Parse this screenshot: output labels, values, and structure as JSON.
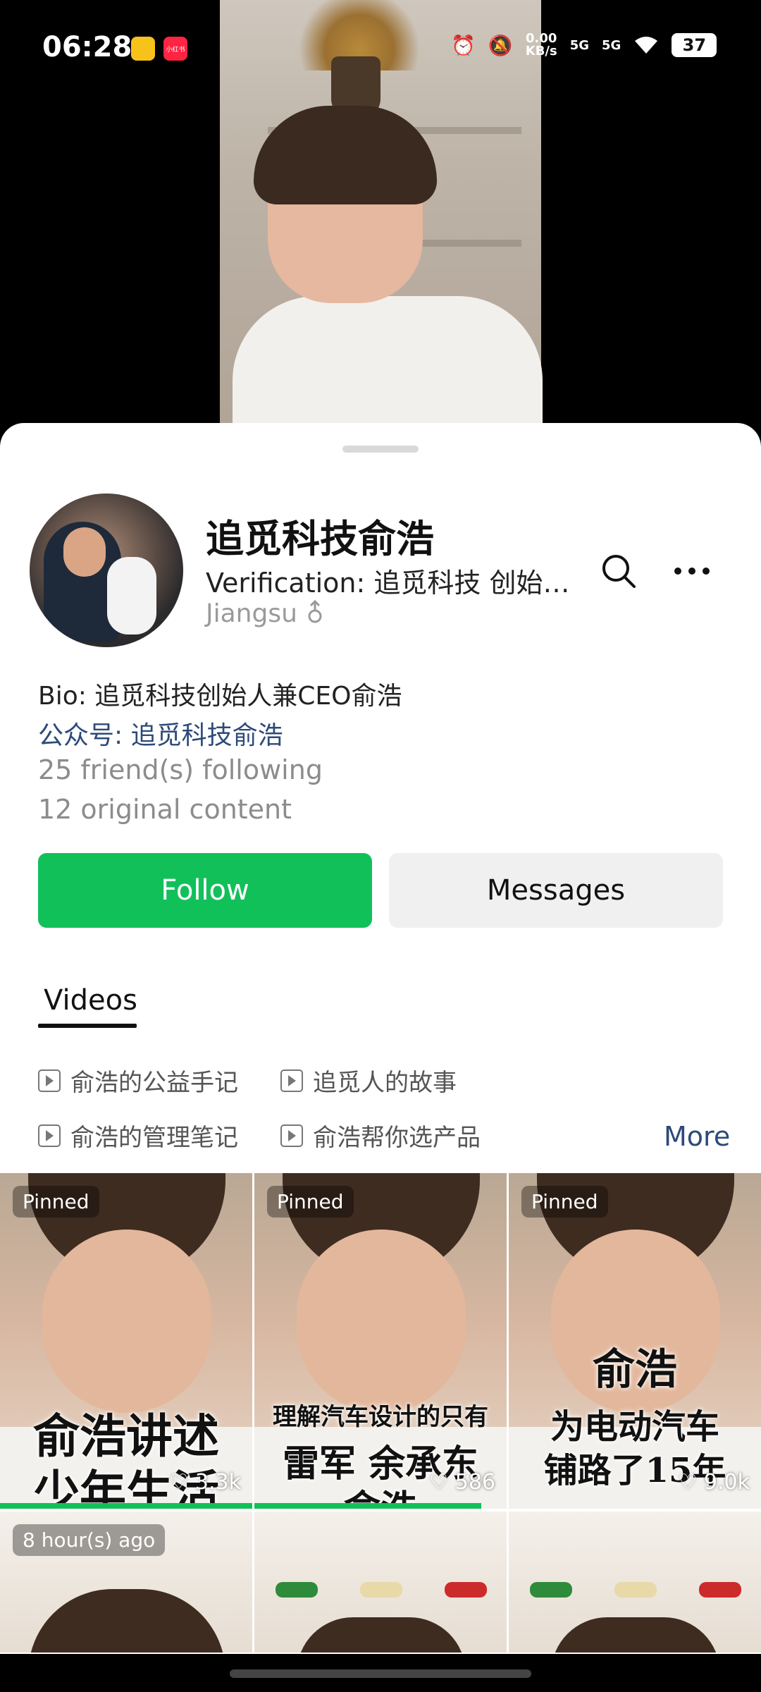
{
  "status_bar": {
    "time": "06:28",
    "net_speed_value": "0.00",
    "net_speed_unit": "KB/s",
    "signal_1": "5G",
    "signal_2": "5G",
    "battery": "37",
    "icons": [
      "weibo-app-icon",
      "xiaohongshu-app-icon",
      "alarm-icon",
      "mute-icon",
      "wifi-icon",
      "battery-icon"
    ],
    "xhs_label": "小红书"
  },
  "profile": {
    "name": "追觅科技俞浩",
    "verification": "Verification: 追觅科技 创始…",
    "region": "Jiangsu",
    "gender_icon": "male-icon",
    "bio": "Bio: 追觅科技创始人兼CEO俞浩",
    "official_account": "公众号: 追觅科技俞浩",
    "following": "25 friend(s) following",
    "original_content": "12 original content"
  },
  "actions": {
    "follow": "Follow",
    "messages": "Messages"
  },
  "tabs": {
    "videos": "Videos"
  },
  "albums": [
    {
      "label": "俞浩的公益手记"
    },
    {
      "label": "追觅人的故事"
    },
    {
      "label": "俞浩的管理笔记"
    },
    {
      "label": "俞浩帮你选产品"
    }
  ],
  "more_link": "More",
  "videos": [
    {
      "badge": "Pinned",
      "caption_line1": "俞浩讲述",
      "caption_line2": "少年生活",
      "likes": "3.3k",
      "progress": 1.0
    },
    {
      "badge": "Pinned",
      "caption_line1": "理解汽车设计的只有",
      "caption_line2": "雷军  余承东",
      "caption_line3": "俞浩",
      "likes": "586",
      "progress": 0.9
    },
    {
      "badge": "Pinned",
      "caption_line1": "俞浩",
      "caption_line2": "为电动汽车",
      "caption_line3": "铺路了15年",
      "likes": "9.0k",
      "progress": 0
    },
    {
      "badge": "8 hour(s) ago"
    },
    {},
    {}
  ],
  "colors": {
    "accent_green": "#12c05a",
    "link_blue": "#2c4a78"
  }
}
